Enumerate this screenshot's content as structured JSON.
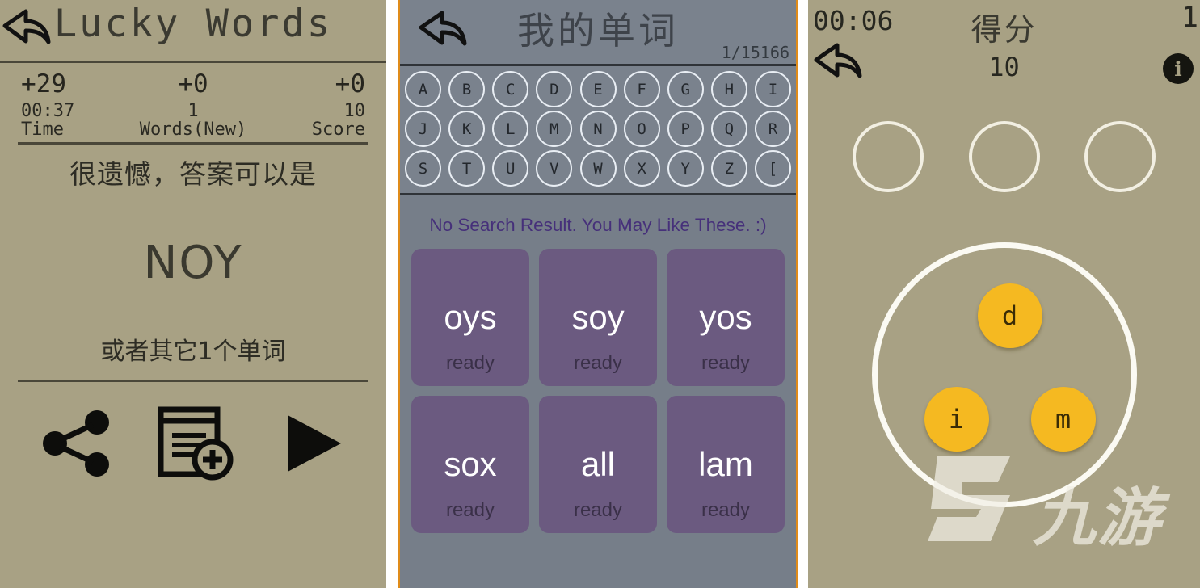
{
  "panel_result": {
    "title": "Lucky Words",
    "back_icon": "back-arrow-icon",
    "deltas": [
      "+29",
      "+0",
      "+0"
    ],
    "values": [
      "00:37",
      "1",
      "10"
    ],
    "labels": [
      "Time",
      "Words(New)",
      "Score"
    ],
    "message": "很遗憾，答案可以是",
    "answer_word": "NOY",
    "sub_message": "或者其它1个单词",
    "actions": [
      {
        "icon": "share-icon",
        "name": "share-button"
      },
      {
        "icon": "add-to-wordbook-icon",
        "name": "add-word-button"
      },
      {
        "icon": "play-icon",
        "name": "play-next-button"
      }
    ]
  },
  "panel_words": {
    "title": "我的单词",
    "back_icon": "back-arrow-icon",
    "counter": "1/15166",
    "alphabet_rows": [
      [
        "A",
        "B",
        "C",
        "D",
        "E",
        "F",
        "G",
        "H",
        "I"
      ],
      [
        "J",
        "K",
        "L",
        "M",
        "N",
        "O",
        "P",
        "Q",
        "R"
      ],
      [
        "S",
        "T",
        "U",
        "V",
        "W",
        "X",
        "Y",
        "Z",
        "["
      ]
    ],
    "no_result_text": "No Search Result. You May Like These. :)",
    "cards": [
      {
        "word": "oys",
        "status": "ready"
      },
      {
        "word": "soy",
        "status": "ready"
      },
      {
        "word": "yos",
        "status": "ready"
      },
      {
        "word": "sox",
        "status": "ready"
      },
      {
        "word": "all",
        "status": "ready"
      },
      {
        "word": "lam",
        "status": "ready"
      }
    ],
    "colors": {
      "background": "#767e89",
      "card": "#6b5a80",
      "border": "#e08c1a",
      "link": "#46307a"
    }
  },
  "panel_game": {
    "timer": "00:06",
    "back_icon": "back-arrow-icon",
    "score_label": "得分",
    "score_value": "10",
    "level": "1",
    "info_icon": "info-icon",
    "slot_count": 3,
    "tiles": [
      "d",
      "i",
      "m"
    ],
    "watermark_text": "九游",
    "colors": {
      "background": "#a8a184",
      "tile": "#f5b921",
      "ring": "#fbfaf3"
    }
  }
}
